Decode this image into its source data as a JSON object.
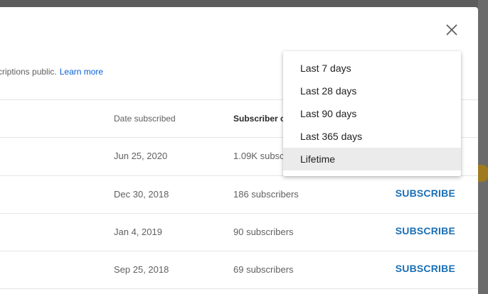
{
  "info": {
    "text": "criptions public.",
    "link": "Learn more"
  },
  "table": {
    "headers": {
      "date": "Date subscribed",
      "subscribers": "Subscriber c"
    },
    "rows": [
      {
        "date": "Jun 25, 2020",
        "subscribers": "1.09K subsc",
        "action": ""
      },
      {
        "date": "Dec 30, 2018",
        "subscribers": "186 subscribers",
        "action": "SUBSCRIBE"
      },
      {
        "date": "Jan 4, 2019",
        "subscribers": "90 subscribers",
        "action": "SUBSCRIBE"
      },
      {
        "date": "Sep 25, 2018",
        "subscribers": "69 subscribers",
        "action": "SUBSCRIBE"
      }
    ]
  },
  "dropdown": {
    "items": [
      {
        "label": "Last 7 days"
      },
      {
        "label": "Last 28 days"
      },
      {
        "label": "Last 90 days"
      },
      {
        "label": "Last 365 days"
      },
      {
        "label": "Lifetime",
        "selected": true
      }
    ]
  },
  "colors": {
    "link": "#065fd4",
    "subscribe": "#1a6fb5",
    "selected_bg": "#ebebeb"
  },
  "icons": {
    "close": "close-icon"
  }
}
